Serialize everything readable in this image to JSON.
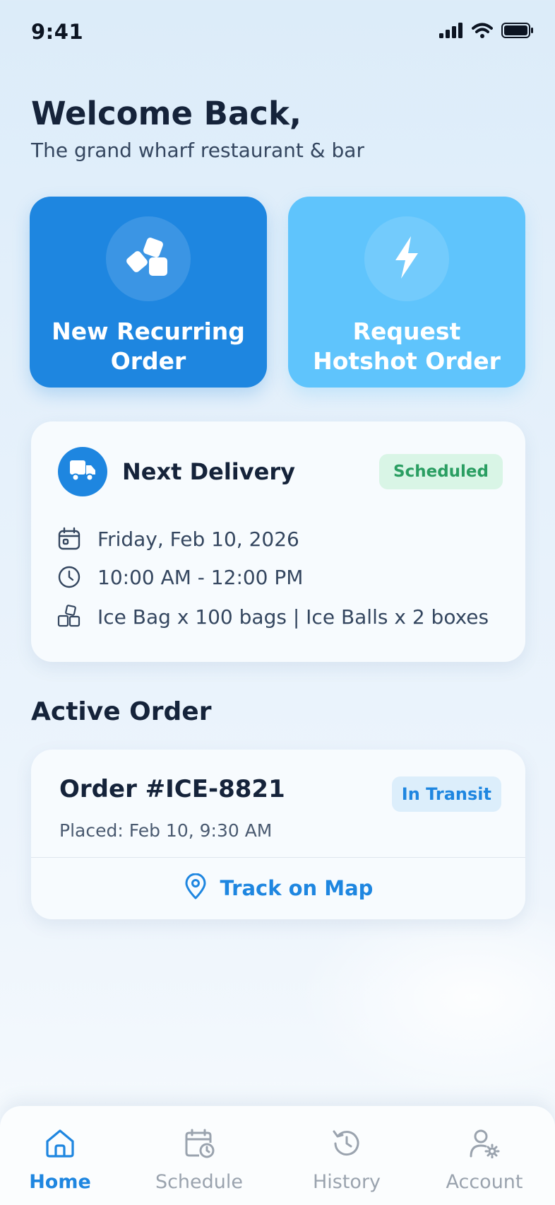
{
  "status_bar": {
    "time": "9:41"
  },
  "header": {
    "title": "Welcome Back,",
    "subtitle": "The grand wharf restaurant & bar"
  },
  "actions": [
    {
      "label": "New Recurring Order",
      "icon": "ice-cubes-icon",
      "color": "#1e86e0"
    },
    {
      "label": "Request Hotshot Order",
      "icon": "lightning-icon",
      "color": "#5fc4fc"
    }
  ],
  "next_delivery": {
    "title": "Next Delivery",
    "status": "Scheduled",
    "date": "Friday, Feb 10, 2026",
    "time_window": "10:00 AM - 12:00 PM",
    "items": "Ice Bag x 100 bags | Ice Balls x 2 boxes"
  },
  "active_order": {
    "section_title": "Active Order",
    "order_number": "Order #ICE-8821",
    "placed": "Placed: Feb 10, 9:30 AM",
    "status": "In Transit",
    "track_label": "Track on Map"
  },
  "nav": {
    "items": [
      {
        "label": "Home",
        "icon": "home-icon",
        "active": true
      },
      {
        "label": "Schedule",
        "icon": "calendar-clock-icon",
        "active": false
      },
      {
        "label": "History",
        "icon": "history-icon",
        "active": false
      },
      {
        "label": "Account",
        "icon": "user-settings-icon",
        "active": false
      }
    ]
  },
  "colors": {
    "primary": "#1e86e0",
    "secondary": "#5fc4fc",
    "success": "#2a9e62",
    "text_dark": "#15233a",
    "nav_inactive": "#9aa3ae"
  }
}
